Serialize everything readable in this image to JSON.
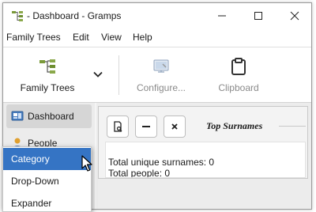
{
  "window": {
    "title": " - Dashboard - Gramps",
    "controls": {
      "minimize": "minimize",
      "maximize": "maximize",
      "close": "close"
    }
  },
  "menubar": {
    "items": [
      "Family Trees",
      "Edit",
      "View",
      "Help"
    ]
  },
  "toolbar": {
    "family_trees_label": "Family Trees",
    "configure_label": "Configure...",
    "clipboard_label": "Clipboard"
  },
  "sidebar": {
    "items": [
      {
        "label": "Dashboard",
        "icon": "dashboard-icon",
        "active": true
      },
      {
        "label": "People",
        "icon": "people-icon",
        "active": false
      }
    ]
  },
  "gramplet": {
    "title": "Top Surnames",
    "line1": "Total unique surnames: 0",
    "line2": "Total people: 0"
  },
  "dropdown": {
    "items": [
      {
        "label": "Category",
        "selected": true
      },
      {
        "label": "Drop-Down",
        "selected": false
      },
      {
        "label": "Expander",
        "selected": false
      }
    ]
  },
  "colors": {
    "selection": "#3574c4",
    "window_bg": "#f5f5f5",
    "sidebar_bg": "#ececec"
  }
}
